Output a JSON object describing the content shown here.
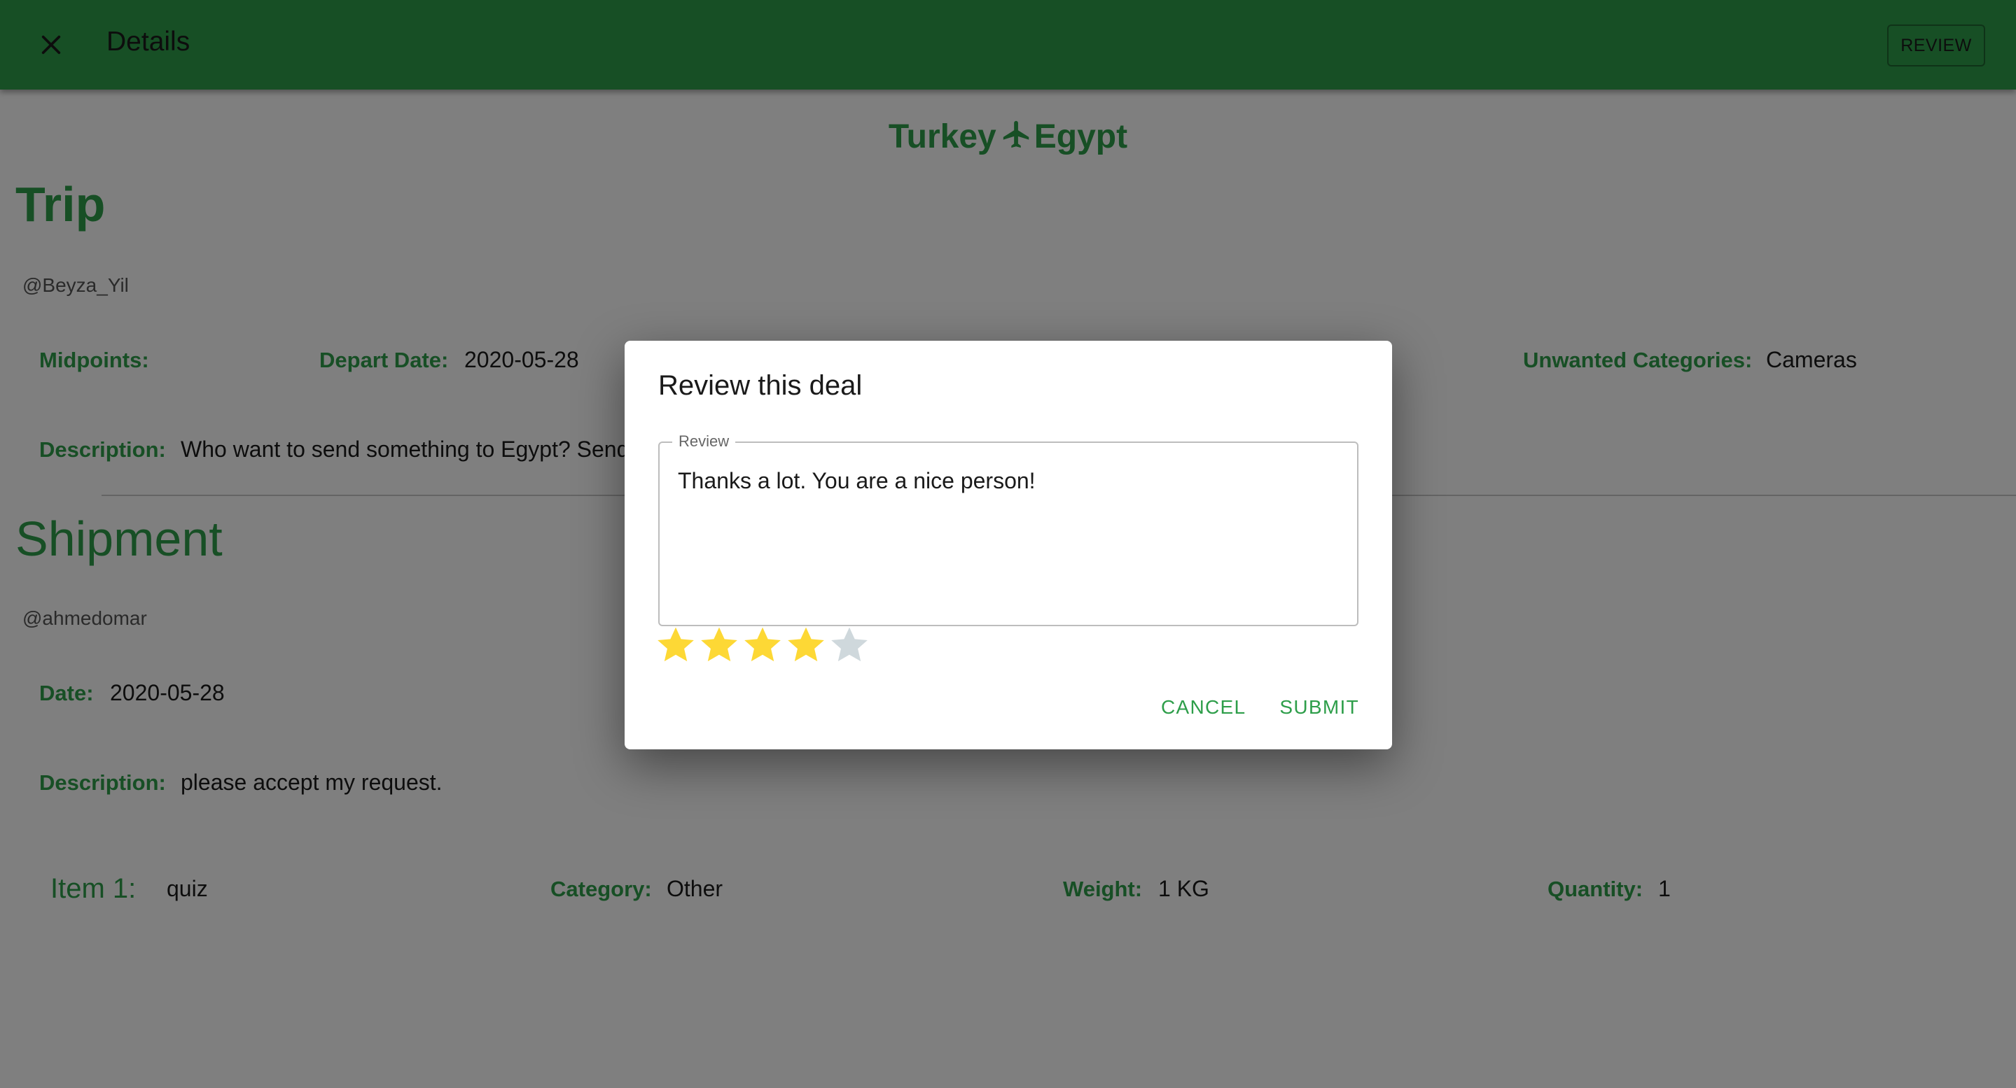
{
  "appbar": {
    "title": "Details",
    "review_button": "REVIEW",
    "close_icon": "close-icon",
    "bar_color": "#2e9e4a"
  },
  "route": {
    "from": "Turkey",
    "to": "Egypt",
    "icon": "airplane-icon"
  },
  "trip": {
    "heading": "Trip",
    "username": "@Beyza_Yil",
    "midpoints_label": "Midpoints:",
    "midpoints_value": "",
    "depart_label": "Depart Date:",
    "depart_value": "2020-05-28",
    "unwanted_label": "Unwanted Categories:",
    "unwanted_value": "Cameras",
    "description_label": "Description:",
    "description_value": "Who want to send something to Egypt? Send"
  },
  "shipment": {
    "heading": "Shipment",
    "username": "@ahmedomar",
    "date_label": "Date:",
    "date_value": "2020-05-28",
    "description_label": "Description:",
    "description_value": "please accept my request.",
    "items": [
      {
        "label": "Item 1:",
        "name": "quiz",
        "category_label": "Category:",
        "category": "Other",
        "weight_label": "Weight:",
        "weight": "1 KG",
        "quantity_label": "Quantity:",
        "quantity": "1"
      }
    ]
  },
  "dialog": {
    "title": "Review this deal",
    "field_label": "Review",
    "review_text": "Thanks a lot. You are a nice person!",
    "rating": 4,
    "rating_max": 5,
    "star_filled_color": "#fdd835",
    "star_empty_color": "#cfd8dc",
    "cancel": "CANCEL",
    "submit": "SUBMIT"
  },
  "colors": {
    "accent": "#2e9e4a",
    "scrim": "rgba(0,0,0,0.5)"
  }
}
